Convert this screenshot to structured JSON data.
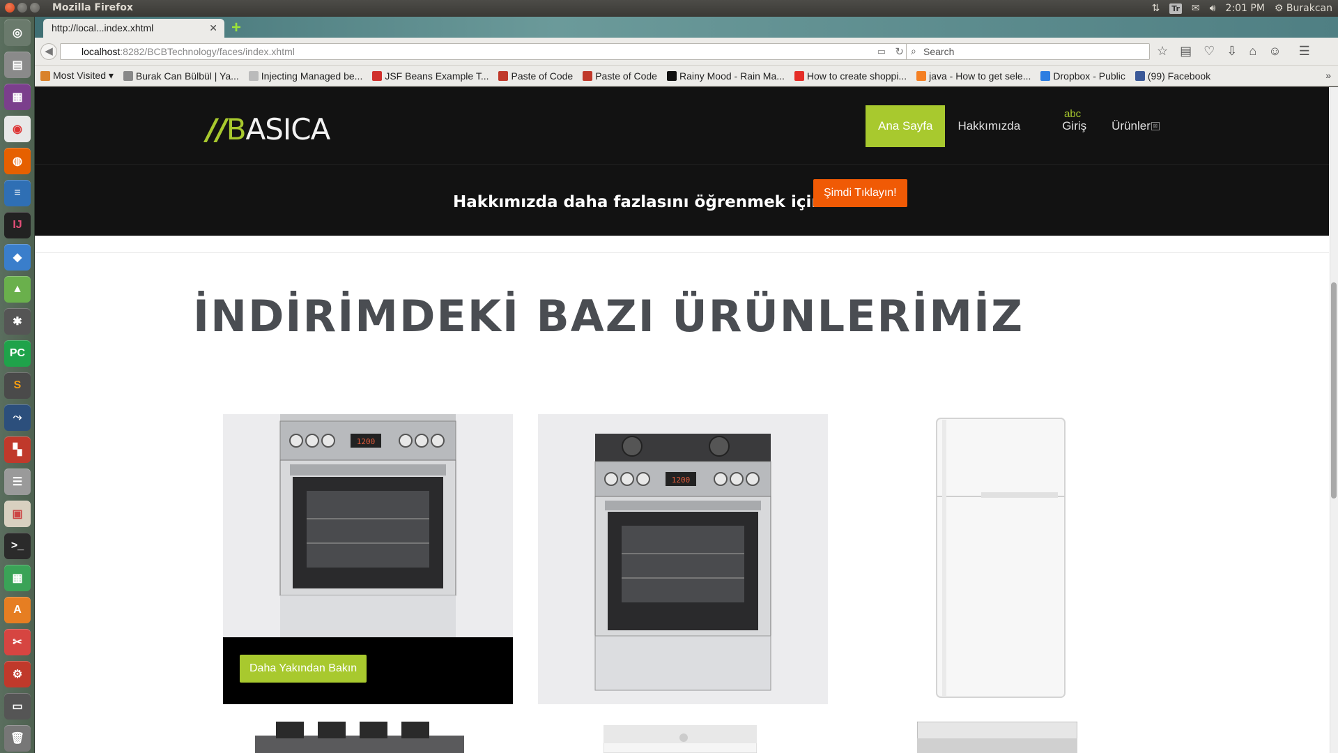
{
  "os": {
    "app_title": "Mozilla Firefox",
    "time": "2:01 PM",
    "user": "Burakcan",
    "tray_tr": "Tr"
  },
  "browser": {
    "tab_title": "http://local...index.xhtml",
    "url_host": "localhost",
    "url_rest": ":8282/BCBTechnology/faces/index.xhtml",
    "search_placeholder": "Search",
    "bookmarks": [
      {
        "label": "Most Visited ▾",
        "color": "#d9822b"
      },
      {
        "label": "Burak Can Bülbül | Ya...",
        "color": "#888888"
      },
      {
        "label": "Injecting Managed be...",
        "color": "#bbbbbb"
      },
      {
        "label": "JSF Beans Example T...",
        "color": "#d0312d"
      },
      {
        "label": "Paste of Code",
        "color": "#c0392b"
      },
      {
        "label": "Paste of Code",
        "color": "#c0392b"
      },
      {
        "label": "Rainy Mood - Rain Ma...",
        "color": "#111111"
      },
      {
        "label": "How to create shoppi...",
        "color": "#e52d27"
      },
      {
        "label": "java - How to get sele...",
        "color": "#f48024"
      },
      {
        "label": "Dropbox - Public",
        "color": "#2d7de1"
      },
      {
        "label": "(99) Facebook",
        "color": "#3b5998"
      }
    ]
  },
  "site": {
    "logo_slashes": "//",
    "logo_b": "B",
    "logo_rest": "ASICA",
    "nav": {
      "home": "Ana Sayfa",
      "about": "Hakkımızda",
      "abc": "abc",
      "login": "Giriş",
      "products": "Ürünler"
    },
    "promo_text": "Hakkımızda daha fazlasını öğrenmek için",
    "promo_button": "Şimdi Tıklayın!",
    "section_title": "İNDİRİMDEKİ BAZI ÜRÜNLERİMİZ",
    "more_button": "Daha Yakından Bakın",
    "brand_accent": "#a8c92e",
    "cta_color": "#f05a05"
  }
}
